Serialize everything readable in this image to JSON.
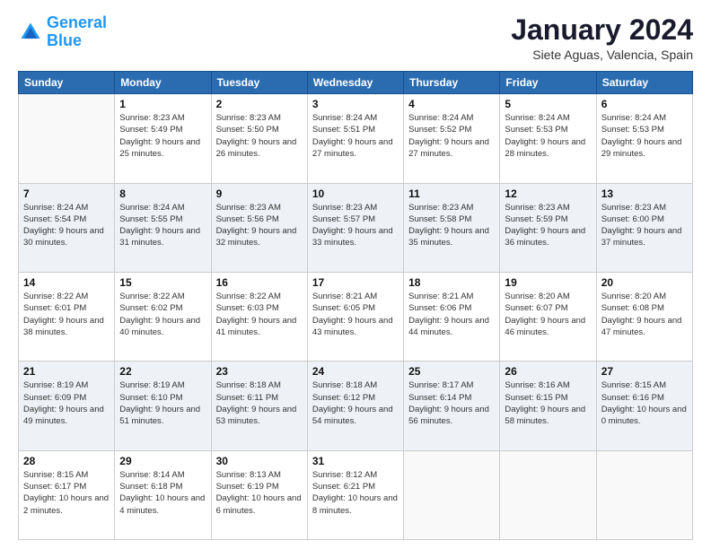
{
  "logo": {
    "line1": "General",
    "line2": "Blue"
  },
  "title": "January 2024",
  "subtitle": "Siete Aguas, Valencia, Spain",
  "days_of_week": [
    "Sunday",
    "Monday",
    "Tuesday",
    "Wednesday",
    "Thursday",
    "Friday",
    "Saturday"
  ],
  "weeks": [
    [
      {
        "day": "",
        "empty": true
      },
      {
        "day": "1",
        "sunrise": "Sunrise: 8:23 AM",
        "sunset": "Sunset: 5:49 PM",
        "daylight": "Daylight: 9 hours and 25 minutes."
      },
      {
        "day": "2",
        "sunrise": "Sunrise: 8:23 AM",
        "sunset": "Sunset: 5:50 PM",
        "daylight": "Daylight: 9 hours and 26 minutes."
      },
      {
        "day": "3",
        "sunrise": "Sunrise: 8:24 AM",
        "sunset": "Sunset: 5:51 PM",
        "daylight": "Daylight: 9 hours and 27 minutes."
      },
      {
        "day": "4",
        "sunrise": "Sunrise: 8:24 AM",
        "sunset": "Sunset: 5:52 PM",
        "daylight": "Daylight: 9 hours and 27 minutes."
      },
      {
        "day": "5",
        "sunrise": "Sunrise: 8:24 AM",
        "sunset": "Sunset: 5:53 PM",
        "daylight": "Daylight: 9 hours and 28 minutes."
      },
      {
        "day": "6",
        "sunrise": "Sunrise: 8:24 AM",
        "sunset": "Sunset: 5:53 PM",
        "daylight": "Daylight: 9 hours and 29 minutes."
      }
    ],
    [
      {
        "day": "7",
        "sunrise": "Sunrise: 8:24 AM",
        "sunset": "Sunset: 5:54 PM",
        "daylight": "Daylight: 9 hours and 30 minutes."
      },
      {
        "day": "8",
        "sunrise": "Sunrise: 8:24 AM",
        "sunset": "Sunset: 5:55 PM",
        "daylight": "Daylight: 9 hours and 31 minutes."
      },
      {
        "day": "9",
        "sunrise": "Sunrise: 8:23 AM",
        "sunset": "Sunset: 5:56 PM",
        "daylight": "Daylight: 9 hours and 32 minutes."
      },
      {
        "day": "10",
        "sunrise": "Sunrise: 8:23 AM",
        "sunset": "Sunset: 5:57 PM",
        "daylight": "Daylight: 9 hours and 33 minutes."
      },
      {
        "day": "11",
        "sunrise": "Sunrise: 8:23 AM",
        "sunset": "Sunset: 5:58 PM",
        "daylight": "Daylight: 9 hours and 35 minutes."
      },
      {
        "day": "12",
        "sunrise": "Sunrise: 8:23 AM",
        "sunset": "Sunset: 5:59 PM",
        "daylight": "Daylight: 9 hours and 36 minutes."
      },
      {
        "day": "13",
        "sunrise": "Sunrise: 8:23 AM",
        "sunset": "Sunset: 6:00 PM",
        "daylight": "Daylight: 9 hours and 37 minutes."
      }
    ],
    [
      {
        "day": "14",
        "sunrise": "Sunrise: 8:22 AM",
        "sunset": "Sunset: 6:01 PM",
        "daylight": "Daylight: 9 hours and 38 minutes."
      },
      {
        "day": "15",
        "sunrise": "Sunrise: 8:22 AM",
        "sunset": "Sunset: 6:02 PM",
        "daylight": "Daylight: 9 hours and 40 minutes."
      },
      {
        "day": "16",
        "sunrise": "Sunrise: 8:22 AM",
        "sunset": "Sunset: 6:03 PM",
        "daylight": "Daylight: 9 hours and 41 minutes."
      },
      {
        "day": "17",
        "sunrise": "Sunrise: 8:21 AM",
        "sunset": "Sunset: 6:05 PM",
        "daylight": "Daylight: 9 hours and 43 minutes."
      },
      {
        "day": "18",
        "sunrise": "Sunrise: 8:21 AM",
        "sunset": "Sunset: 6:06 PM",
        "daylight": "Daylight: 9 hours and 44 minutes."
      },
      {
        "day": "19",
        "sunrise": "Sunrise: 8:20 AM",
        "sunset": "Sunset: 6:07 PM",
        "daylight": "Daylight: 9 hours and 46 minutes."
      },
      {
        "day": "20",
        "sunrise": "Sunrise: 8:20 AM",
        "sunset": "Sunset: 6:08 PM",
        "daylight": "Daylight: 9 hours and 47 minutes."
      }
    ],
    [
      {
        "day": "21",
        "sunrise": "Sunrise: 8:19 AM",
        "sunset": "Sunset: 6:09 PM",
        "daylight": "Daylight: 9 hours and 49 minutes."
      },
      {
        "day": "22",
        "sunrise": "Sunrise: 8:19 AM",
        "sunset": "Sunset: 6:10 PM",
        "daylight": "Daylight: 9 hours and 51 minutes."
      },
      {
        "day": "23",
        "sunrise": "Sunrise: 8:18 AM",
        "sunset": "Sunset: 6:11 PM",
        "daylight": "Daylight: 9 hours and 53 minutes."
      },
      {
        "day": "24",
        "sunrise": "Sunrise: 8:18 AM",
        "sunset": "Sunset: 6:12 PM",
        "daylight": "Daylight: 9 hours and 54 minutes."
      },
      {
        "day": "25",
        "sunrise": "Sunrise: 8:17 AM",
        "sunset": "Sunset: 6:14 PM",
        "daylight": "Daylight: 9 hours and 56 minutes."
      },
      {
        "day": "26",
        "sunrise": "Sunrise: 8:16 AM",
        "sunset": "Sunset: 6:15 PM",
        "daylight": "Daylight: 9 hours and 58 minutes."
      },
      {
        "day": "27",
        "sunrise": "Sunrise: 8:15 AM",
        "sunset": "Sunset: 6:16 PM",
        "daylight": "Daylight: 10 hours and 0 minutes."
      }
    ],
    [
      {
        "day": "28",
        "sunrise": "Sunrise: 8:15 AM",
        "sunset": "Sunset: 6:17 PM",
        "daylight": "Daylight: 10 hours and 2 minutes."
      },
      {
        "day": "29",
        "sunrise": "Sunrise: 8:14 AM",
        "sunset": "Sunset: 6:18 PM",
        "daylight": "Daylight: 10 hours and 4 minutes."
      },
      {
        "day": "30",
        "sunrise": "Sunrise: 8:13 AM",
        "sunset": "Sunset: 6:19 PM",
        "daylight": "Daylight: 10 hours and 6 minutes."
      },
      {
        "day": "31",
        "sunrise": "Sunrise: 8:12 AM",
        "sunset": "Sunset: 6:21 PM",
        "daylight": "Daylight: 10 hours and 8 minutes."
      },
      {
        "day": "",
        "empty": true
      },
      {
        "day": "",
        "empty": true
      },
      {
        "day": "",
        "empty": true
      }
    ]
  ]
}
